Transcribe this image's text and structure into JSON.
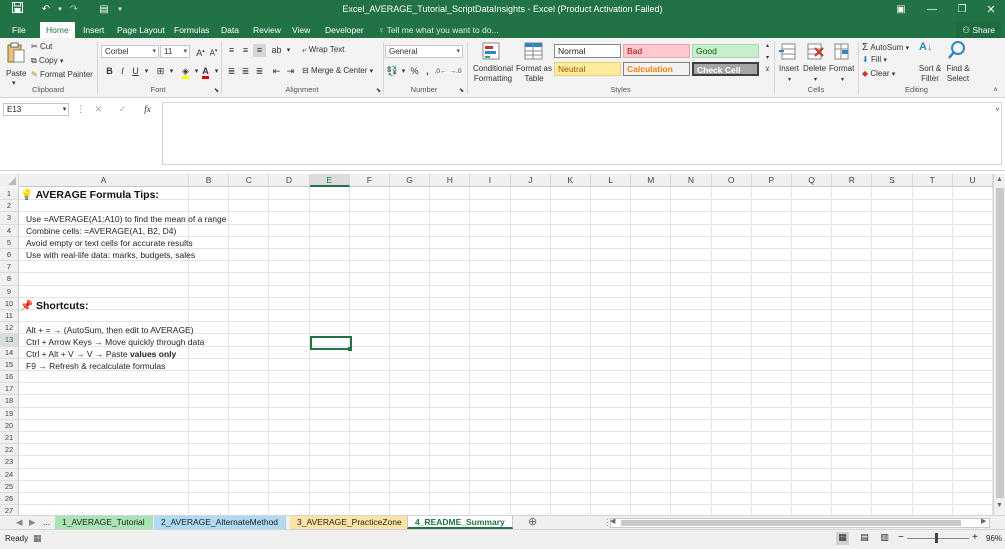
{
  "window": {
    "title": "Excel_AVERAGE_Tutorial_ScriptDataInsights - Excel (Product Activation Failed)"
  },
  "ribbon_tabs": [
    "File",
    "Home",
    "Insert",
    "Page Layout",
    "Formulas",
    "Data",
    "Review",
    "View",
    "Developer"
  ],
  "active_tab": "Home",
  "tell_me": "Tell me what you want to do...",
  "share_label": "Share",
  "clipboard": {
    "paste": "Paste",
    "cut": "Cut",
    "copy": "Copy",
    "format_painter": "Format Painter",
    "label": "Clipboard"
  },
  "font": {
    "name": "Corbel",
    "size": "11",
    "label": "Font",
    "bold": "B",
    "italic": "I",
    "underline": "U"
  },
  "alignment": {
    "wrap_text": "Wrap Text",
    "merge_center": "Merge & Center",
    "label": "Alignment"
  },
  "number": {
    "format": "General",
    "label": "Number"
  },
  "styles": {
    "conditional_formatting": "Conditional Formatting",
    "format_as_table": "Format as Table",
    "normal": "Normal",
    "bad": "Bad",
    "good": "Good",
    "neutral": "Neutral",
    "calculation": "Calculation",
    "check_cell": "Check Cell",
    "label": "Styles",
    "colors": {
      "bad_bg": "#ffc7ce",
      "bad_fg": "#9c0006",
      "good_bg": "#c6efce",
      "good_fg": "#006100",
      "neutral_bg": "#ffeb9c",
      "neutral_fg": "#9c5700",
      "calc_fg": "#fa7d00",
      "check_bg": "#a5a5a5"
    }
  },
  "cells_group": {
    "insert": "Insert",
    "delete": "Delete",
    "format": "Format",
    "label": "Cells"
  },
  "editing": {
    "autosum": "AutoSum",
    "fill": "Fill",
    "clear": "Clear",
    "sort_filter": "Sort & Filter",
    "find_select": "Find & Select",
    "label": "Editing"
  },
  "formula_bar": {
    "name_box": "E13",
    "fx": "fx",
    "formula": ""
  },
  "columns": [
    "A",
    "B",
    "C",
    "D",
    "E",
    "F",
    "G",
    "H",
    "I",
    "J",
    "K",
    "L",
    "M",
    "N",
    "O",
    "P",
    "Q",
    "R",
    "S",
    "T",
    "U"
  ],
  "selected_column": "E",
  "rows": [
    "1",
    "2",
    "3",
    "4",
    "5",
    "6",
    "7",
    "8",
    "9",
    "10",
    "11",
    "12",
    "13",
    "14",
    "15",
    "16",
    "17",
    "18",
    "19",
    "20",
    "21",
    "22",
    "23",
    "24",
    "25",
    "26",
    "27"
  ],
  "selected_row": "13",
  "sheet_content": {
    "heading1": "AVERAGE Formula Tips:",
    "tip1": "Use =AVERAGE(A1:A10) to find the mean of a range",
    "tip2": "Combine cells: =AVERAGE(A1, B2, D4)",
    "tip3": "Avoid empty or text cells for accurate results",
    "tip4": "Use with real-life data: marks, budgets, sales",
    "heading2": "Shortcuts:",
    "sc1": "Alt + = → (AutoSum, then edit to AVERAGE)",
    "sc2": "Ctrl + Arrow Keys → Move quickly through data",
    "sc3_prefix": "Ctrl + Alt + V → V → Paste ",
    "sc3_bold": "values only",
    "sc4": "F9 → Refresh & recalculate formulas"
  },
  "sheet_tabs": [
    {
      "label": "1_AVERAGE_Tutorial",
      "color": "#a9e5b4"
    },
    {
      "label": "2_AVERAGE_AlternateMethod",
      "color": "#aedaf3"
    },
    {
      "label": "3_AVERAGE_PracticeZone",
      "color": "#fbe5a6"
    },
    {
      "label": "4_README_Summary",
      "color": "#ffffff"
    }
  ],
  "ellipsis": "...",
  "status": {
    "ready": "Ready",
    "zoom": "96%"
  }
}
